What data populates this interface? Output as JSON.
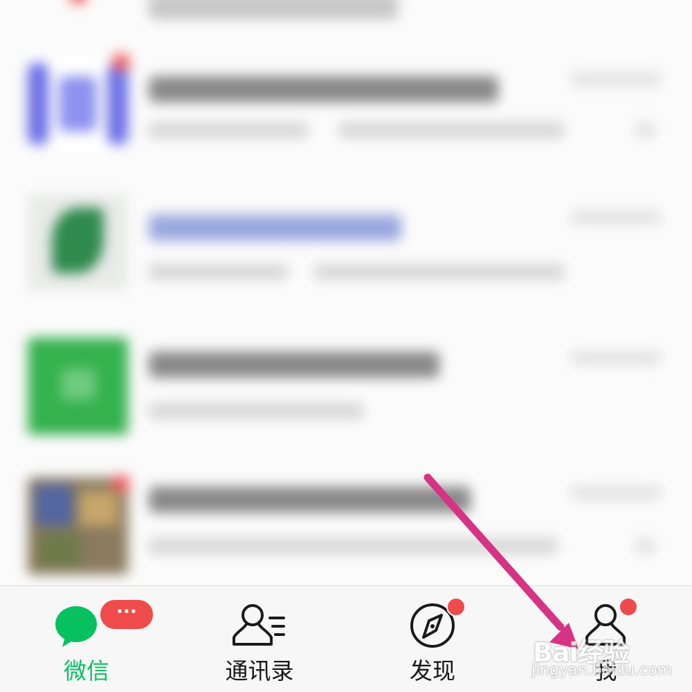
{
  "chat_list": {
    "items": [
      {
        "avatar": "blue-app-logo",
        "title": "",
        "preview": "",
        "time": "",
        "unread_dot": true
      },
      {
        "avatar": "green-leaf-logo",
        "title": "",
        "preview": "",
        "time": "",
        "unread_dot": false
      },
      {
        "avatar": "green-square-logo",
        "title": "",
        "preview": "",
        "time": "",
        "unread_dot": false
      },
      {
        "avatar": "photo-collage",
        "title": "",
        "preview": "",
        "time": "",
        "unread_dot": true
      }
    ]
  },
  "tabbar": {
    "tabs": [
      {
        "label": "微信",
        "icon": "chat-bubbles-icon",
        "active": true,
        "badge": "···"
      },
      {
        "label": "通讯录",
        "icon": "contacts-icon",
        "active": false
      },
      {
        "label": "发现",
        "icon": "compass-icon",
        "active": false,
        "badge_dot": true
      },
      {
        "label": "我",
        "icon": "person-icon",
        "active": false,
        "badge_dot": true
      }
    ]
  },
  "annotation": {
    "type": "arrow",
    "color": "#d63384",
    "points_to": "我"
  },
  "watermark": {
    "brand": "Bai经验",
    "url": "jingyan.baidu.com"
  },
  "colors": {
    "accent": "#07c160",
    "badge": "#f04b4b",
    "arrow": "#d63384",
    "tabbar_bg": "#f7f7f7"
  }
}
